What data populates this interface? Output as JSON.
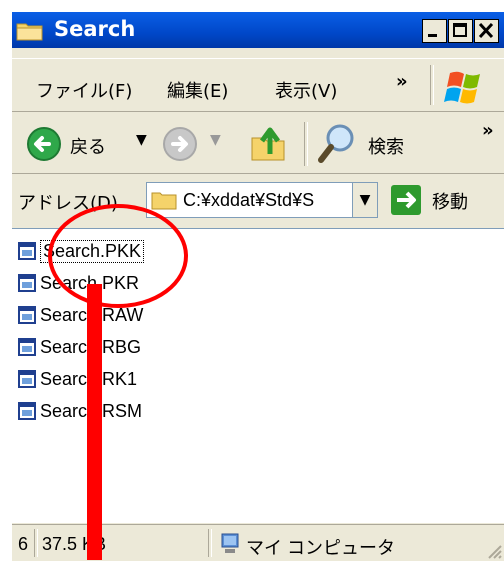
{
  "window": {
    "title": "Search"
  },
  "menu": {
    "items": [
      "ファイル(F)",
      "編集(E)",
      "表示(V)"
    ],
    "overflow": "»"
  },
  "toolbar": {
    "back_label": "戻る",
    "search_label": "検索",
    "overflow": "»"
  },
  "address": {
    "label": "アドレス(D)",
    "value": "C:¥xddat¥Std¥S",
    "go_label": "移動"
  },
  "files": [
    "Search.PKK",
    "Search.PKR",
    "Search.RAW",
    "Search.RBG",
    "Search.RK1",
    "Search.RSM"
  ],
  "status": {
    "count": "6",
    "size": "37.5 KB",
    "location": "マイ コンピュータ"
  },
  "colors": {
    "title_bar": "#0047C8",
    "annotation": "#FF0000",
    "go_arrow": "#2E9A2E"
  }
}
